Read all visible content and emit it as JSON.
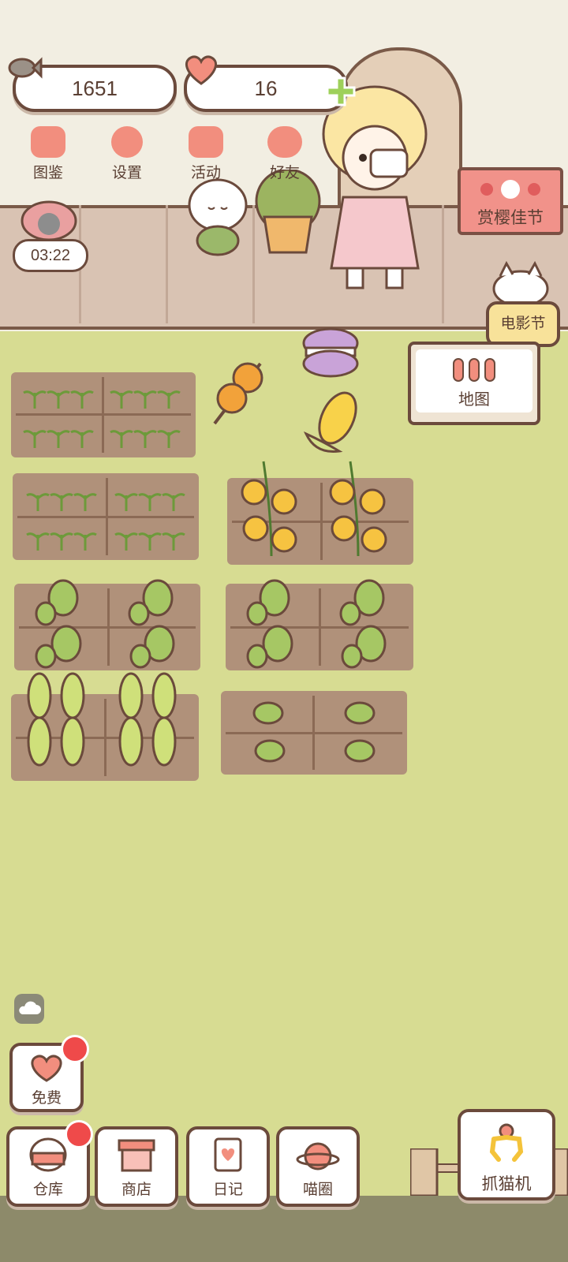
{
  "currency": {
    "fish_count": "1651",
    "heart_count": "16"
  },
  "top_menu": [
    {
      "label": "图鉴",
      "icon": "cat-book-icon"
    },
    {
      "label": "设置",
      "icon": "gear-icon"
    },
    {
      "label": "活动",
      "icon": "gift-icon"
    },
    {
      "label": "好友",
      "icon": "friends-icon"
    }
  ],
  "timer": "03:22",
  "signs": {
    "festival": "赏樱佳节",
    "movie_festival": "电影节",
    "map": "地图"
  },
  "bottom_bar": {
    "free": "免费",
    "warehouse": "仓库",
    "shop": "商店",
    "diary": "日记",
    "cat_circle": "喵圈",
    "claw_machine": "抓猫机"
  },
  "colors": {
    "accent_pink": "#f28e7e",
    "outline_brown": "#6b4a3c",
    "grass": "#d7dc92",
    "soil": "#b0917a",
    "badge_red": "#ef4a4a"
  }
}
